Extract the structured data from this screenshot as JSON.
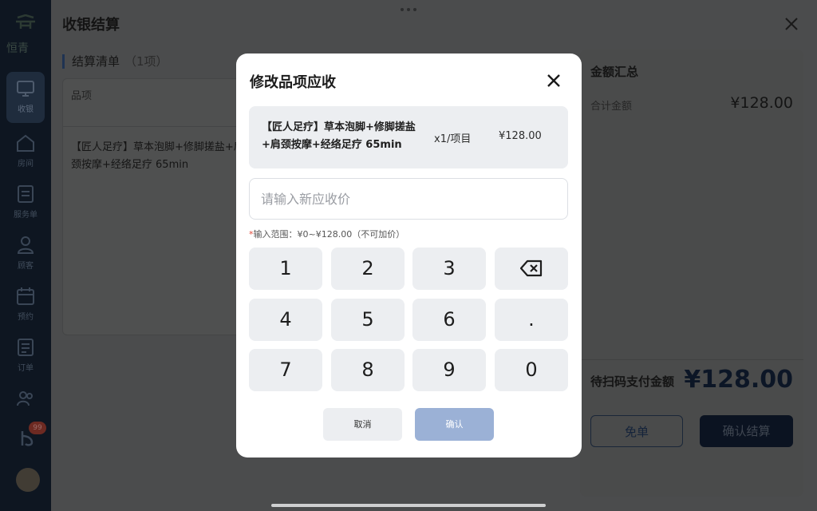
{
  "sidebar": {
    "brand": "恒青",
    "items": [
      {
        "label": "收银",
        "icon": "cashier-monitor-icon",
        "active": true
      },
      {
        "label": "房间",
        "icon": "home-icon"
      },
      {
        "label": "服务单",
        "icon": "document-icon"
      },
      {
        "label": "顾客",
        "icon": "user-icon"
      },
      {
        "label": "预约",
        "icon": "calendar-icon"
      },
      {
        "label": "订单",
        "icon": "order-icon"
      },
      {
        "label": "",
        "icon": "staff-icon"
      }
    ],
    "badge": "99"
  },
  "panel": {
    "title": "收银结算",
    "list_title": "结算清单",
    "list_count": "（1项）",
    "column_item": "品项",
    "row_item_text": "【匠人足疗】草本泡脚+修脚搓盐+肩颈按摩+经络足疗 65min",
    "summary": {
      "title": "金额汇总",
      "total_label": "合计金额",
      "total_value": "¥128.00",
      "pay_label": "待扫码支付金额",
      "pay_value": "¥128.00",
      "free_button": "免单",
      "confirm_button": "确认结算"
    }
  },
  "modal": {
    "title": "修改品项应收",
    "item_name": "【匠人足疗】草本泡脚+修脚搓盐+肩颈按摩+经络足疗 65min",
    "item_qty": "x1/项目",
    "item_price": "¥128.00",
    "input_placeholder": "请输入新应收价",
    "input_value": "",
    "hint_star": "*",
    "hint_text": "输入范围：¥0~¥128.00（不可加价）",
    "keys": [
      "1",
      "2",
      "3",
      "backspace",
      "4",
      "5",
      "6",
      ".",
      "7",
      "8",
      "9",
      "0"
    ],
    "cancel_label": "取消",
    "confirm_label": "确认"
  },
  "colors": {
    "confirm_disabled": "#9bb1d6",
    "keypad_bg": "#eceef1",
    "hint_star": "#e24a3b",
    "navy": "#1f3352"
  }
}
